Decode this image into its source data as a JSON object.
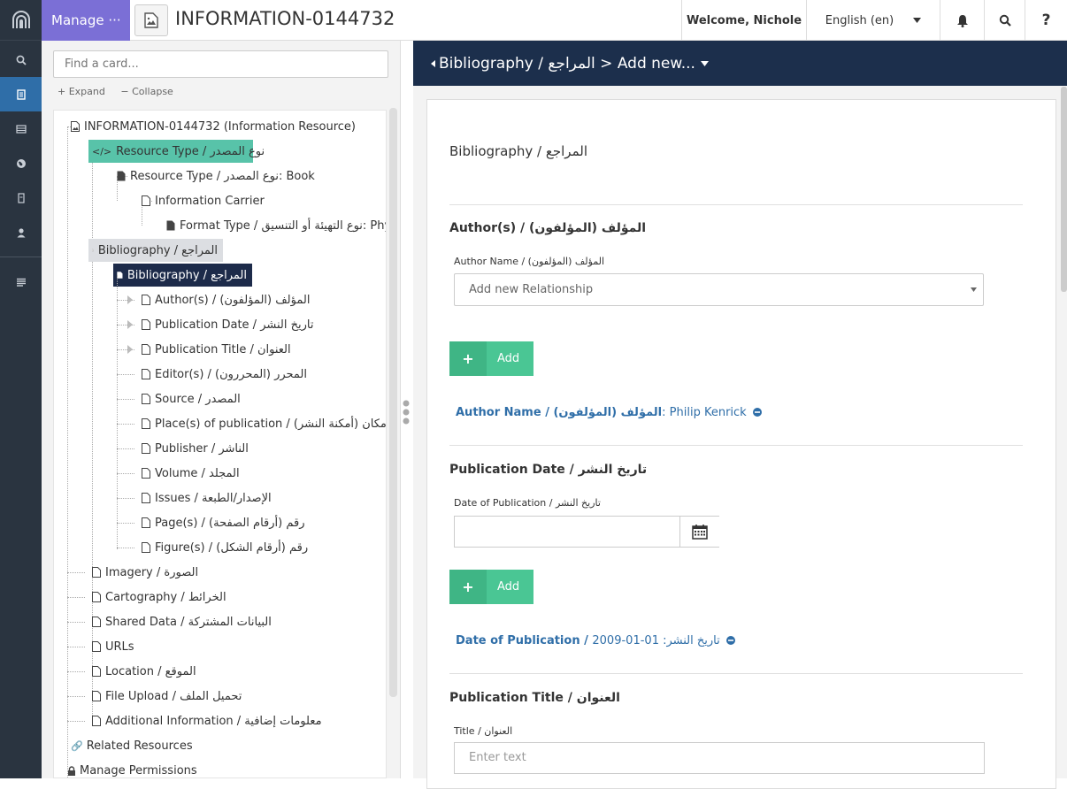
{
  "topbar": {
    "manage_label": "Manage ···",
    "page_title": "INFORMATION-0144732",
    "welcome": "Welcome, Nichole",
    "language": "English (en)"
  },
  "left": {
    "find_placeholder": "Find a card...",
    "expand": "Expand",
    "collapse": "Collapse",
    "tree": [
      {
        "label": "INFORMATION-0144732 (Information Resource)"
      },
      {
        "label": "Resource Type / نوع المصدر"
      },
      {
        "label": "Resource Type / نوع المصدر: Book"
      },
      {
        "label": "Information Carrier"
      },
      {
        "label": "Format Type / نوع التهيئة أو التنسيق: Physical"
      },
      {
        "label": "Bibliography / المراجع"
      },
      {
        "label": "Bibliography / المراجع"
      },
      {
        "label": "Author(s) / (المؤلف (المؤلفون"
      },
      {
        "label": "Publication Date / تاريخ النشر"
      },
      {
        "label": "Publication Title / العنوان"
      },
      {
        "label": "Editor(s) / (المحرر (المحررون"
      },
      {
        "label": "Source / المصدر"
      },
      {
        "label": "Place(s) of publication / (مكان (أمكنة النشر"
      },
      {
        "label": "Publisher / الناشر"
      },
      {
        "label": "Volume / المجلد"
      },
      {
        "label": "Issues / الإصدار/الطبعة"
      },
      {
        "label": "Page(s) / (رقم (أرقام الصفحة"
      },
      {
        "label": "Figure(s) / (رقم (أرقام الشكل"
      },
      {
        "label": "Imagery / الصورة"
      },
      {
        "label": "Cartography / الخرائط"
      },
      {
        "label": "Shared Data / البيانات المشتركة"
      },
      {
        "label": "URLs"
      },
      {
        "label": "Location / الموقع"
      },
      {
        "label": "File Upload / تحميل الملف"
      },
      {
        "label": "Additional Information / معلومات إضافية"
      },
      {
        "label": "Related Resources"
      },
      {
        "label": "Manage Permissions"
      }
    ]
  },
  "right": {
    "header": "Bibliography / المراجع > Add new...",
    "card_title": "Bibliography / المراجع",
    "authors_title": "Author(s) / (المؤلف (المؤلفون",
    "author_name_label": "Author Name / (المؤلف (المؤلفون",
    "author_select_placeholder": "Add new Relationship",
    "add_label": "Add",
    "author_rel_key": "Author Name / (المؤلف (المؤلفون",
    "author_rel_value": ": Philip Kenrick",
    "pubdate_title": "Publication Date / تاريخ النشر",
    "date_label": "Date of Publication / تاريخ النشر",
    "date_rel_key": "Date of Publication / ",
    "date_rel_value": "تاريخ النشر: 01-01-2009",
    "pubtitle_title": "Publication Title / العنوان",
    "title_label": "Title / العنوان",
    "title_placeholder": "Enter text"
  },
  "colors": {
    "rail": "#2a3440",
    "manage": "#7b6fd6",
    "header": "#1c2f4c",
    "add_green": "#4ac694",
    "tree_green": "#58c3a9",
    "tree_dark": "#1d2b4a",
    "link": "#2f6ea8"
  }
}
